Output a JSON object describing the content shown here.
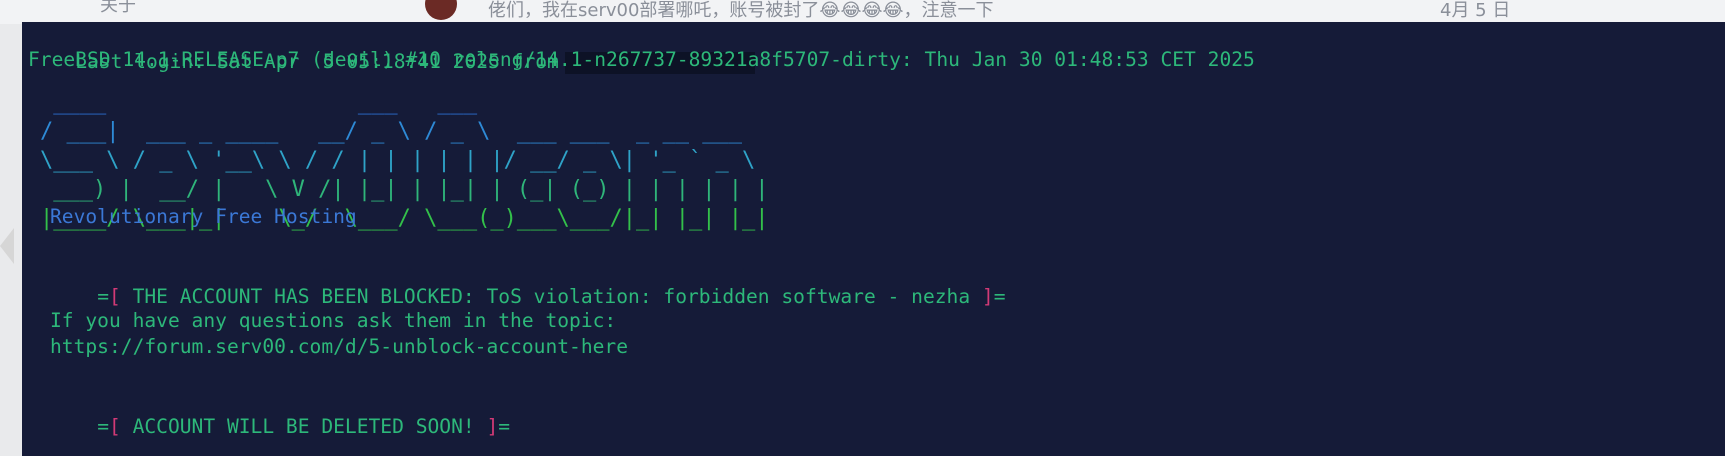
{
  "background_app": {
    "left_text": "关于",
    "message_preview": "佬们，我在serv00部署哪吒，账号被封了😂😂😂😂，注意一下",
    "date": "4月 5 日"
  },
  "terminal": {
    "login_line": "Last login: Sat Apr  5 05:18:41 2025 from",
    "kernel_line": "FreeBSD 14.1-RELEASE-p7 (devil) #10 releng/14.1-n267737-89321a8f5707-dirty: Thu Jan 30 01:48:53 CET 2025",
    "banner_lines": [
      " ____                   ___   ___",
      "/ ___|  ___ _ ____   __/ _ \\ / _ \\  ___ ___  _ __ ___",
      "\\___ \\ / _ \\ '__\\ \\ / / | | | | | |/ __/ _ \\| '_ ` _ \\",
      " ___) |  __/ |   \\ V /| |_| | |_| | (_| (_) | | | | | |",
      "|____/ \\___|_|    \\_/  \\___/ \\___(_)___\\___/|_| |_| |_|"
    ],
    "tagline": "Revolutionary Free Hosting",
    "blocked_notice": {
      "prefix": "=",
      "open": "[",
      "text": " THE ACCOUNT HAS BEEN BLOCKED: ToS violation: forbidden software - nezha ",
      "close": "]",
      "suffix": "="
    },
    "questions_line": "If you have any questions ask them in the topic:",
    "topic_url": "https://forum.serv00.com/d/5-unblock-account-here",
    "deleted_notice": {
      "prefix": "=",
      "open": "[",
      "text": " ACCOUNT WILL BE DELETED SOON! ",
      "close": "]",
      "suffix": "="
    }
  },
  "colors": {
    "terminal_bg": "#151b38",
    "text_green": "#2db87a",
    "bracket_pink": "#d23a76",
    "tagline_blue": "#3b78d6"
  }
}
